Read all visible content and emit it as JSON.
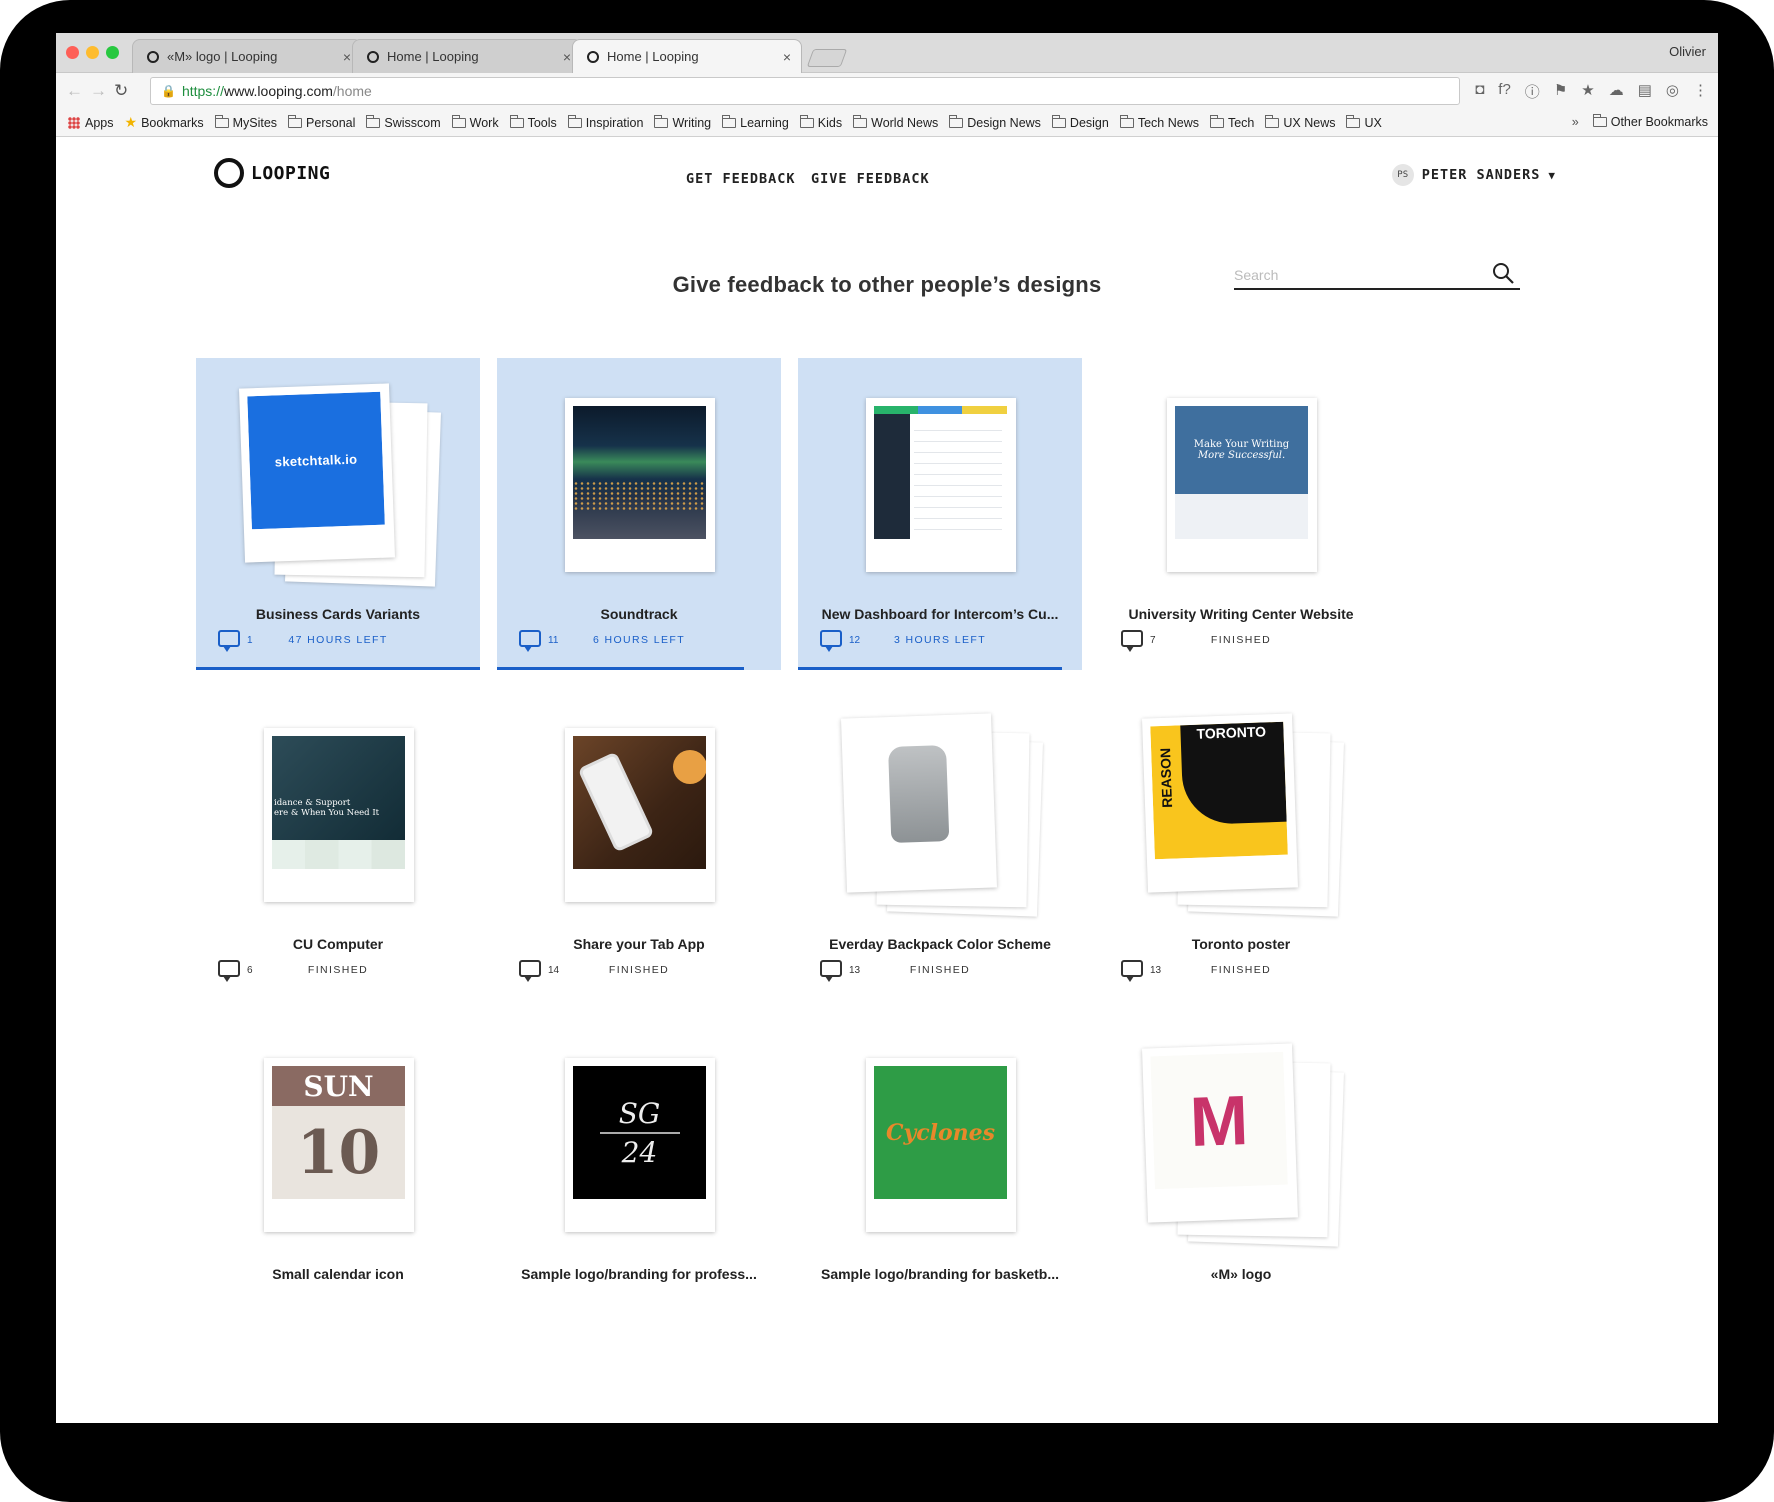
{
  "browser": {
    "tabs": [
      {
        "title": "«M» logo | Looping",
        "active": false
      },
      {
        "title": "Home | Looping",
        "active": false
      },
      {
        "title": "Home | Looping",
        "active": true
      }
    ],
    "tab_close": "×",
    "profile_name": "Olivier",
    "url": {
      "scheme": "https://",
      "host": "www.looping.com",
      "path": "/home"
    },
    "nav_back": "←",
    "nav_forward": "→",
    "nav_reload": "↻",
    "extensions": [
      "pocket-icon",
      "font-icon",
      "info-icon",
      "translate-icon",
      "star-icon",
      "cloud-icon",
      "analytics-icon",
      "camera-icon",
      "menu-icon"
    ],
    "extension_glyphs": [
      "◘",
      "f?",
      "ⓘ",
      "⚑",
      "★",
      "☁",
      "▤",
      "◎",
      "⋮"
    ],
    "bookmarks": [
      {
        "label": "Apps",
        "kind": "apps"
      },
      {
        "label": "Bookmarks",
        "kind": "star"
      },
      {
        "label": "MySites",
        "kind": "folder"
      },
      {
        "label": "Personal",
        "kind": "folder"
      },
      {
        "label": "Swisscom",
        "kind": "folder"
      },
      {
        "label": "Work",
        "kind": "folder"
      },
      {
        "label": "Tools",
        "kind": "folder"
      },
      {
        "label": "Inspiration",
        "kind": "folder"
      },
      {
        "label": "Writing",
        "kind": "folder"
      },
      {
        "label": "Learning",
        "kind": "folder"
      },
      {
        "label": "Kids",
        "kind": "folder"
      },
      {
        "label": "World News",
        "kind": "folder"
      },
      {
        "label": "Design News",
        "kind": "folder"
      },
      {
        "label": "Design",
        "kind": "folder"
      },
      {
        "label": "Tech News",
        "kind": "folder"
      },
      {
        "label": "Tech",
        "kind": "folder"
      },
      {
        "label": "UX News",
        "kind": "folder"
      },
      {
        "label": "UX",
        "kind": "folder"
      }
    ],
    "overflow": "»",
    "other_bookmarks": "Other Bookmarks"
  },
  "site": {
    "logo_text": "LOOPING",
    "nav": {
      "get_feedback": "GET FEEDBACK",
      "give_feedback": "GIVE FEEDBACK"
    },
    "user": {
      "initials": "PS",
      "name": "PETER SANDERS",
      "caret": "▼"
    },
    "heading": "Give feedback to other people’s designs",
    "search_placeholder": "Search"
  },
  "colors": {
    "accent": "#1a5fc8",
    "active_card": "#cfe0f4"
  },
  "cards": [
    {
      "title": "Business Cards Variants",
      "comments": "1",
      "status": "47 HOURS LEFT",
      "active": true,
      "progress": 1.0,
      "stacked": true
    },
    {
      "title": "Soundtrack",
      "comments": "11",
      "status": "6 HOURS LEFT",
      "active": true,
      "progress": 0.87,
      "stacked": false
    },
    {
      "title": "New Dashboard for Intercom’s Cu...",
      "comments": "12",
      "status": "3 HOURS LEFT",
      "active": true,
      "progress": 0.93,
      "stacked": false
    },
    {
      "title": "University Writing Center Website",
      "comments": "7",
      "status": "FINISHED",
      "active": false,
      "stacked": false
    },
    {
      "title": "CU Computer",
      "comments": "6",
      "status": "FINISHED",
      "active": false,
      "stacked": false
    },
    {
      "title": "Share your Tab App",
      "comments": "14",
      "status": "FINISHED",
      "active": false,
      "stacked": false
    },
    {
      "title": "Everday Backpack Color Scheme",
      "comments": "13",
      "status": "FINISHED",
      "active": false,
      "stacked": true
    },
    {
      "title": "Toronto poster",
      "comments": "13",
      "status": "FINISHED",
      "active": false,
      "stacked": true
    },
    {
      "title": "Small calendar icon",
      "comments": "",
      "status": "",
      "active": false,
      "stacked": false
    },
    {
      "title": "Sample logo/branding for profess...",
      "comments": "",
      "status": "",
      "active": false,
      "stacked": false
    },
    {
      "title": "Sample logo/branding for basketb...",
      "comments": "",
      "status": "",
      "active": false,
      "stacked": false
    },
    {
      "title": "«M» logo",
      "comments": "",
      "status": "",
      "active": false,
      "stacked": true
    }
  ],
  "thumb_text": {
    "sketchtalk": "sketchtalk.io",
    "sketchtalk_back": ".io",
    "writing_line1": "Make Your Writing",
    "writing_line2": "More Successful.",
    "cu_line1": "idance & Support",
    "cu_line2": "ere & When You Need It",
    "toronto": "TORONTO",
    "reason": "REASON",
    "cal_day": "SUN",
    "cal_date": "10",
    "sg_top": "SG",
    "sg_bottom": "24",
    "cyclones": "Cyclones",
    "m_letter": "M"
  }
}
